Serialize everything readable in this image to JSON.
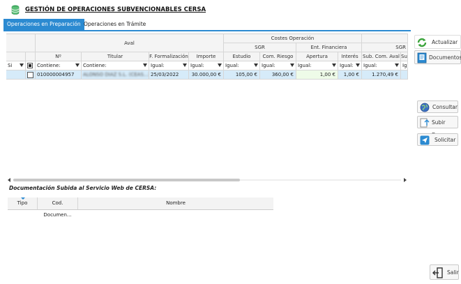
{
  "header": {
    "title": "GESTIÓN DE OPERACIONES SUBVENCIONABLES CERSA",
    "icon": "database-icon"
  },
  "tabs": [
    {
      "label": "Operaciones en Preparación",
      "active": true
    },
    {
      "label": "Operaciones en Trámite",
      "active": false
    }
  ],
  "grid": {
    "group_headers": {
      "aval": "Aval",
      "costes": "Costes Operación",
      "sgr": "SGR",
      "ent_fin": "Ent. Financiera",
      "sgr2": "SGR"
    },
    "columns": {
      "si": "Si",
      "n": "Nº",
      "titular": "Titular",
      "fecha": "F. Formalización",
      "importe": "Importe",
      "estudio": "Estudio",
      "com_riesgo": "Com. Riesgo",
      "apertura": "Apertura",
      "interes": "Interés",
      "sub_com": "Sub. Com. Aval",
      "su": "Su"
    },
    "filters": {
      "contiene": "Contiene:",
      "igual": "Igual:",
      "ig": "Ig"
    },
    "rows": [
      {
        "n": "010000004957",
        "titular": "ALONSO DIAZ S.L. (CEAS...)",
        "fecha": "25/03/2022",
        "importe": "30.000,00 €",
        "estudio": "105,00 €",
        "com_riesgo": "360,00 €",
        "apertura": "1,00 €",
        "interes": "1,00 €",
        "sub_com": "1.270,49 €"
      }
    ]
  },
  "doc_section": {
    "title": "Documentación Subida al Servicio Web de CERSA:",
    "columns": [
      "Tipo",
      "Cod. Documen...",
      "Nombre"
    ]
  },
  "buttons": {
    "actualizar": "Actualizar",
    "documentos": "Documentos",
    "consultar": "Consultar",
    "subir_doc": "Subir Doc.",
    "solicitar": "Solicitar",
    "salir": "Salir"
  },
  "colors": {
    "accent": "#2b8ad1",
    "selected_row": "#d6ebf9"
  }
}
